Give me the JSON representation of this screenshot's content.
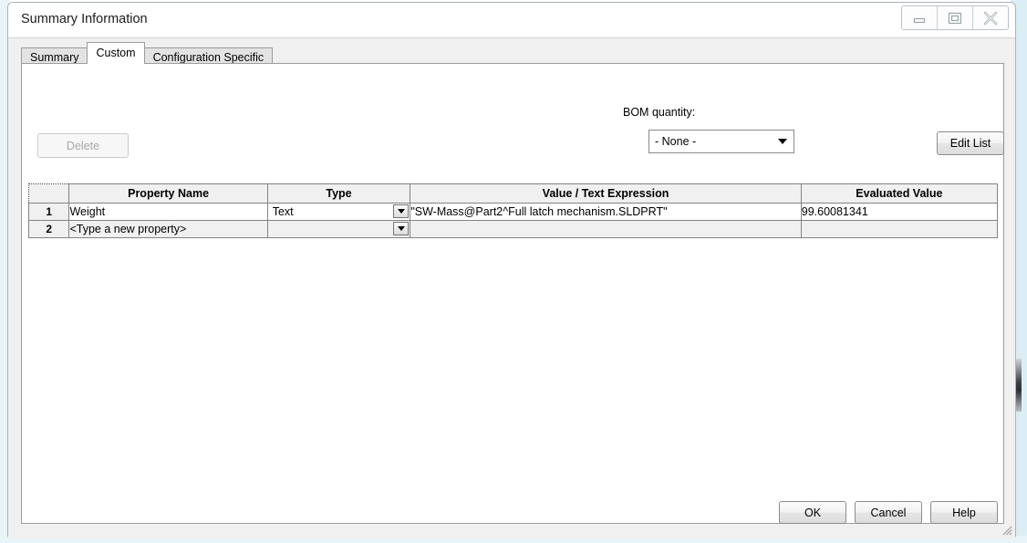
{
  "window": {
    "title": "Summary Information",
    "controls": [
      {
        "name": "minimize",
        "label": "Minimize"
      },
      {
        "name": "maximize",
        "label": "Maximize"
      },
      {
        "name": "close",
        "label": "Close"
      }
    ]
  },
  "tabs": [
    {
      "label": "Summary",
      "active": false
    },
    {
      "label": "Custom",
      "active": true
    },
    {
      "label": "Configuration Specific",
      "active": false
    }
  ],
  "toolbar": {
    "delete_label": "Delete",
    "delete_enabled": false,
    "edit_list_label": "Edit List"
  },
  "bom": {
    "label": "BOM quantity:",
    "selected": "- None -",
    "options": [
      "- None -"
    ]
  },
  "table": {
    "columns": [
      "",
      "Property Name",
      "Type",
      "Value / Text Expression",
      "Evaluated Value"
    ],
    "rows": [
      {
        "num": "1",
        "property_name": "Weight",
        "type": "Text",
        "value_expression": "\"SW-Mass@Part2^Full latch mechanism.SLDPRT\"",
        "evaluated_value": "99.60081341",
        "is_new_row": false
      },
      {
        "num": "2",
        "property_name": "<Type a new property>",
        "type": "",
        "value_expression": "",
        "evaluated_value": "",
        "is_new_row": true
      }
    ]
  },
  "footer": {
    "ok_label": "OK",
    "cancel_label": "Cancel",
    "help_label": "Help"
  },
  "colors": {
    "dialog_background": "#f0f0f0",
    "panel_background": "#ffffff",
    "border": "#9c9c9c",
    "grid_line": "#838383",
    "active_tab": "#ffffff",
    "inactive_tab": "#e3e3e3",
    "disabled_text": "#a8a8a8"
  }
}
